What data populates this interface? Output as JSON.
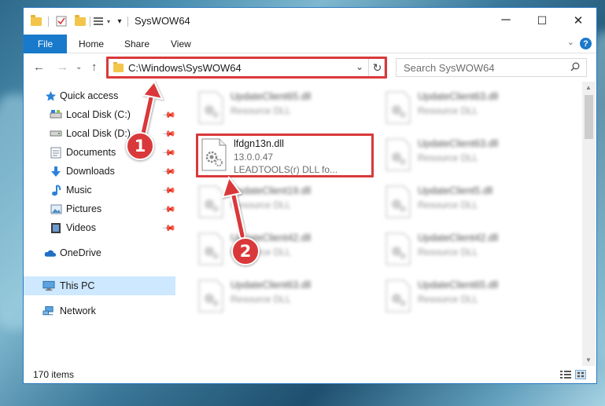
{
  "window": {
    "title": "SysWOW64",
    "controls": {
      "minimize": "─",
      "maximize": "☐",
      "close": "✕"
    }
  },
  "ribbon": {
    "tabs": [
      "File",
      "Home",
      "Share",
      "View"
    ],
    "help": "?",
    "collapse": "⌄"
  },
  "navigation": {
    "back": "←",
    "forward": "→",
    "recent": "⌄",
    "up": "↑",
    "address": "C:\\Windows\\SysWOW64",
    "address_dropdown": "⌄",
    "refresh": "↻",
    "search_placeholder": "Search SysWOW64"
  },
  "sidebar": {
    "items": [
      {
        "label": "Quick access",
        "icon": "star-icon"
      },
      {
        "label": "Local Disk (C:)",
        "icon": "drive-icon",
        "pinned": true
      },
      {
        "label": "Local Disk (D:)",
        "icon": "drive-icon",
        "pinned": true
      },
      {
        "label": "Documents",
        "icon": "documents-icon",
        "pinned": true
      },
      {
        "label": "Downloads",
        "icon": "download-icon",
        "pinned": true
      },
      {
        "label": "Music",
        "icon": "music-icon",
        "pinned": true
      },
      {
        "label": "Pictures",
        "icon": "pictures-icon",
        "pinned": true
      },
      {
        "label": "Videos",
        "icon": "videos-icon",
        "pinned": true
      },
      {
        "label": "OneDrive",
        "icon": "cloud-icon"
      },
      {
        "label": "This PC",
        "icon": "computer-icon",
        "selected": true
      },
      {
        "label": "Network",
        "icon": "network-icon"
      }
    ]
  },
  "files": {
    "left_column": [
      {
        "name": "UpdateClient65.dll",
        "type": "Resource DLL",
        "blurred": true
      },
      {
        "name": "lfdgn13n.dll",
        "version": "13.0.0.47",
        "description": "LEADTOOLS(r) DLL fo...",
        "highlighted": true
      },
      {
        "name": "UpdateClient19.dll",
        "type": "Resource DLL",
        "blurred": true
      },
      {
        "name": "UpdateClient42.dll",
        "type": "Resource DLL",
        "blurred": true
      },
      {
        "name": "UpdateClient63.dll",
        "type": "Resource DLL",
        "blurred": true
      }
    ],
    "right_column": [
      {
        "name": "UpdateClient63.dll",
        "type": "Resource DLL",
        "blurred": true
      },
      {
        "name": "UpdateClient63.dll",
        "type": "Resource DLL",
        "blurred": true
      },
      {
        "name": "UpdateClient5.dll",
        "type": "Resource DLL",
        "blurred": true
      },
      {
        "name": "UpdateClient42.dll",
        "type": "Resource DLL",
        "blurred": true
      },
      {
        "name": "UpdateClient65.dll",
        "type": "Resource DLL",
        "blurred": true
      }
    ]
  },
  "status": {
    "item_count": "170 items"
  },
  "annotations": {
    "step1": "1",
    "step2": "2",
    "color": "#d9393a"
  },
  "colors": {
    "accent": "#1979ca",
    "highlight": "#d9393a",
    "selected": "#cde8ff"
  }
}
